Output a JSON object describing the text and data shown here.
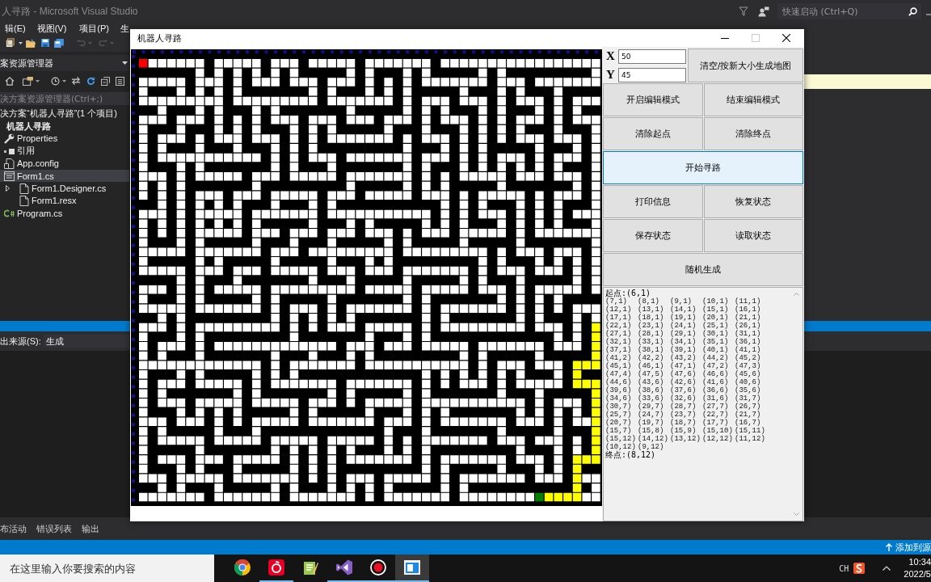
{
  "ide_title_bar": {
    "title": "人寻路 - Microsoft Visual Studio",
    "quick_launch": {
      "placeholder": "快速启动 (Ctrl+Q)"
    }
  },
  "menu_bar": [
    "辑(E)",
    "视图(V)",
    "项目(P)",
    "生"
  ],
  "solution_explorer": {
    "title": "案资源管理器",
    "search": {
      "placeholder": "决方案资源管理器(Ctrl+;)"
    },
    "tree": [
      {
        "label": "决方案“机器人寻路”(1 个项目)",
        "selected": false,
        "children": [
          {
            "label": "机器人寻路",
            "selected": false,
            "children": [
              {
                "label": "Properties",
                "kind": "properties",
                "selected": false
              },
              {
                "label": "引用",
                "kind": "references",
                "selected": false
              },
              {
                "label": "App.config",
                "kind": "config",
                "selected": false
              },
              {
                "label": "Form1.cs",
                "kind": "form",
                "selected": true,
                "children": [
                  {
                    "label": "Form1.Designer.cs",
                    "kind": "file",
                    "selected": false,
                    "expanded": false
                  },
                  {
                    "label": "Form1.resx",
                    "kind": "file",
                    "selected": false
                  }
                ]
              },
              {
                "label": "Program.cs",
                "kind": "code",
                "selected": false
              }
            ]
          }
        ]
      }
    ]
  },
  "output_panel": {
    "source_label": "出来源(S):",
    "source_value": "生成",
    "tabs": [
      "布活动",
      "错误列表",
      "输出"
    ]
  },
  "status_bar": {
    "action": "添加到源"
  },
  "form_window": {
    "title": "机器人寻路",
    "window_buttons": [
      {
        "kind": "minimize",
        "disabled": false
      },
      {
        "kind": "maximize",
        "disabled": true
      },
      {
        "kind": "close",
        "disabled": false
      }
    ],
    "x_field": {
      "label": "X",
      "value": "50"
    },
    "y_field": {
      "label": "Y",
      "value": "45"
    },
    "map_button": {
      "label": "清空/按新大小生成地图",
      "highlighted": false
    },
    "button_rows": [
      [
        {
          "label": "开启编辑模式",
          "highlighted": false
        },
        {
          "label": "结束编辑模式",
          "highlighted": false
        }
      ],
      [
        {
          "label": "清除起点",
          "highlighted": false
        },
        {
          "label": "清除终点",
          "highlighted": false
        }
      ],
      [
        {
          "label": "开始寻路",
          "highlighted": true
        }
      ],
      [
        {
          "label": "打印信息",
          "highlighted": false
        },
        {
          "label": "恢复状态",
          "highlighted": false
        }
      ],
      [
        {
          "label": "保存状态",
          "highlighted": false
        },
        {
          "label": "读取状态",
          "highlighted": false
        }
      ],
      [
        {
          "label": "随机生成",
          "highlighted": false
        }
      ]
    ],
    "log": {
      "start_line": "起点:(6,1)",
      "rows": [
        [
          "(7,1)",
          "(8,1)",
          "(9,1)",
          "(10,1)",
          "(11,1)"
        ],
        [
          "(12,1)",
          "(13,1)",
          "(14,1)",
          "(15,1)",
          "(16,1)"
        ],
        [
          "(17,1)",
          "(18,1)",
          "(19,1)",
          "(20,1)",
          "(21,1)"
        ],
        [
          "(22,1)",
          "(23,1)",
          "(24,1)",
          "(25,1)",
          "(26,1)"
        ],
        [
          "(27,1)",
          "(28,1)",
          "(29,1)",
          "(30,1)",
          "(31,1)"
        ],
        [
          "(32,1)",
          "(33,1)",
          "(34,1)",
          "(35,1)",
          "(36,1)"
        ],
        [
          "(37,1)",
          "(38,1)",
          "(39,1)",
          "(40,1)",
          "(41,1)"
        ],
        [
          "(41,2)",
          "(42,2)",
          "(43,2)",
          "(44,2)",
          "(45,2)"
        ],
        [
          "(45,1)",
          "(46,1)",
          "(47,1)",
          "(47,2)",
          "(47,3)"
        ],
        [
          "(47,4)",
          "(47,5)",
          "(47,6)",
          "(46,6)",
          "(45,6)"
        ],
        [
          "(44,6)",
          "(43,6)",
          "(42,6)",
          "(41,6)",
          "(40,6)"
        ],
        [
          "(39,6)",
          "(38,6)",
          "(37,6)",
          "(36,6)",
          "(35,6)"
        ],
        [
          "(34,6)",
          "(33,6)",
          "(32,6)",
          "(31,6)",
          "(31,7)"
        ],
        [
          "(30,7)",
          "(29,7)",
          "(28,7)",
          "(27,7)",
          "(26,7)"
        ],
        [
          "(25,7)",
          "(24,7)",
          "(23,7)",
          "(22,7)",
          "(21,7)"
        ],
        [
          "(20,7)",
          "(19,7)",
          "(18,7)",
          "(17,7)",
          "(16,7)"
        ],
        [
          "(15,7)",
          "(15,8)",
          "(15,9)",
          "(15,10)",
          "(15,11)"
        ],
        [
          "(15,12)",
          "(14,12)",
          "(13,12)",
          "(12,12)",
          "(11,12)"
        ],
        [
          "(10,12)",
          "(9,12)"
        ]
      ],
      "end_line": "终点:(8,12)"
    }
  },
  "taskbar": {
    "search": {
      "placeholder": "在这里输入你要搜索的内容"
    },
    "apps": [
      {
        "kind": "browser",
        "running": false,
        "active": false
      },
      {
        "kind": "music",
        "running": true,
        "active": false
      },
      {
        "kind": "notepad",
        "running": false,
        "active": false
      },
      {
        "kind": "ide",
        "running": true,
        "active": false
      },
      {
        "kind": "recorder",
        "running": true,
        "active": false
      },
      {
        "kind": "window",
        "running": true,
        "active": true
      }
    ],
    "tray": {
      "language": "CH",
      "time": "10:34",
      "date": "2022/5"
    }
  }
}
